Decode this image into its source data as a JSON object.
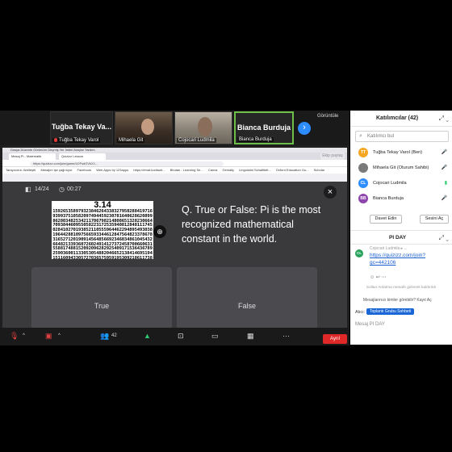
{
  "gallery": {
    "tiles": [
      {
        "big_name": "Tuğba Tekay Va...",
        "name": "Tuğba Tekay Varol"
      },
      {
        "name": "Mihaela Git"
      },
      {
        "name": "Cojocari Ludmila"
      },
      {
        "big_name": "Bianca Burduja",
        "name": "Bianca Burduja"
      }
    ],
    "view_label": "Görüntüle"
  },
  "browser": {
    "menu": "Dosya  Düzenle  Görünüm  Geçmiş  Yer İmleri  Araçlar  Yardım",
    "tabs": [
      "Mesaj Pi - Matematik",
      "Quizizz Lesson"
    ],
    "url": "https://quizizz.com/join/game/U2FsdGVkX1...",
    "bookmarks": [
      "Tarayıcınızı özelleştir",
      "Mesajım işe çağrılıyor",
      "Facebook",
      "Web Apps by 123apps",
      "https://emat.kodlauti...",
      "Bhutan - Learning Se...",
      "Canva",
      "Genially",
      "Linguistini Schaltitelt...",
      "Oxford Education Gu...",
      "Scholar"
    ],
    "share_banner": "Ekip paylaş"
  },
  "quiz": {
    "counter": "14/24",
    "timer": "00:27",
    "image_title": "3.14",
    "image_digits": "15926535897932384626433832795028841971693993751058209749445923078164062862089986280348253421170679821480865132823066470938446095505822317253594081284811174502841027019385211055596446229489549303819644288109756659334461284756482337867831652712019091456485669234603486104543266482133936072602491412737245870066063155881748815209209628292540917153643678925903600113305305488204665213841469519415116094330572703657595919530921861173819326117931051185480744623799627495673518857527248912279381830119491298336733624406566430860213949463952247371907021798609437027705392171762931767523846748184676694051320005681271452635608277857713427577896091736371787214684409012249534301465495853710507922796892589235420199561121290219608640344181598136297747713099605187072113499999983729780499510597317328160963185950244594553469083026425223082533446850352619311881710100031378387528865875332083814206171776691473035982534904287554687311595628638823537875937519577818577805321712268066130019278766111959092164201989",
    "question": "Q. True or False: Pi is the most recognized mathematical constant in the world.",
    "options": [
      "True",
      "False"
    ]
  },
  "toolbar": {
    "participants_count": "42",
    "end_label": "Ayrıl"
  },
  "participants": {
    "title": "Katılımcılar (42)",
    "search_placeholder": "Katılımcı bul",
    "list": [
      {
        "initials": "TT",
        "color": "#f5a623",
        "name": "Tuğba Tekay Varol (Ben)"
      },
      {
        "initials": "",
        "color": "#7a7a7a",
        "name": "Mihaela Git (Oturum Sahibi)"
      },
      {
        "initials": "CL",
        "color": "#2d8cff",
        "name": "Cojocari Ludmila"
      },
      {
        "initials": "BB",
        "color": "#8e44ad",
        "name": "Bianca Burduja"
      }
    ],
    "invite_label": "Davet Edin",
    "mute_label": "Sesini Aç"
  },
  "chat": {
    "title": "PI DAY",
    "sender": "Cojocari Ludmila ▸ ...",
    "avatar": "CL",
    "link": "https://quizizz.com/join?gc=442106",
    "hidden_note": "Sollan Anlatma mesafe gizlerek kaldırıldı",
    "who_can_see": "Mesajlarınızı kimler görebilir? Kayıt Aç",
    "to_label": "Alıcı:",
    "to_target": "Toplantı Grubu Sohbeti",
    "input_placeholder": "Mesaj PI DAY"
  }
}
